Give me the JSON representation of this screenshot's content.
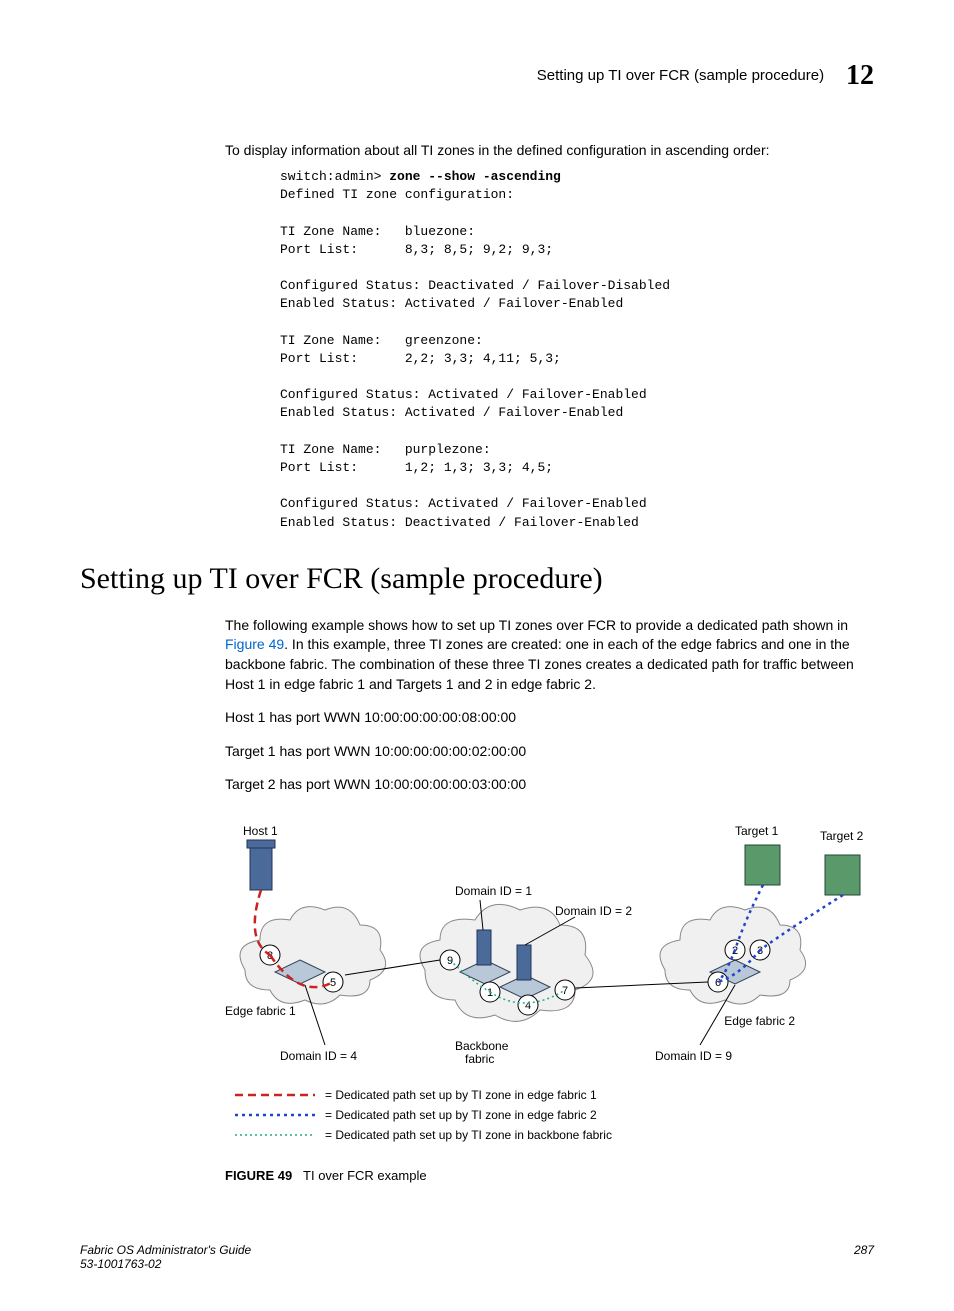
{
  "header": {
    "title": "Setting up TI over FCR (sample procedure)",
    "chapter": "12"
  },
  "intro": "To display information about all TI zones in the defined configuration in ascending order:",
  "cli": {
    "prompt": "switch:admin> ",
    "command": "zone --show -ascending",
    "output": "Defined TI zone configuration:\n\nTI Zone Name:   bluezone:\nPort List:      8,3; 8,5; 9,2; 9,3;\n\nConfigured Status: Deactivated / Failover-Disabled\nEnabled Status: Activated / Failover-Enabled\n\nTI Zone Name:   greenzone:\nPort List:      2,2; 3,3; 4,11; 5,3;\n\nConfigured Status: Activated / Failover-Enabled\nEnabled Status: Activated / Failover-Enabled\n\nTI Zone Name:   purplezone:\nPort List:      1,2; 1,3; 3,3; 4,5;\n\nConfigured Status: Activated / Failover-Enabled\nEnabled Status: Deactivated / Failover-Enabled"
  },
  "section_heading": "Setting up TI over FCR (sample procedure)",
  "para1_a": "The following example shows how to set up TI zones over FCR to provide a dedicated path shown in ",
  "para1_link": "Figure 49",
  "para1_b": ". In this example, three TI zones are created: one in each of the edge fabrics and one in the backbone fabric. The combination of these three TI zones creates a dedicated path for traffic between Host 1 in edge fabric 1 and Targets 1 and 2 in edge fabric 2.",
  "wwn_lines": {
    "host1": "Host 1 has port WWN 10:00:00:00:00:08:00:00",
    "target1": "Target 1 has port WWN 10:00:00:00:00:02:00:00",
    "target2": "Target 2 has port WWN 10:00:00:00:00:03:00:00"
  },
  "diagram": {
    "host1": "Host 1",
    "target1": "Target 1",
    "target2": "Target 2",
    "domain1": "Domain ID = 1",
    "domain2": "Domain ID = 2",
    "domain4": "Domain ID = 4",
    "domain9": "Domain ID = 9",
    "edge1": "Edge fabric 1",
    "edge2": "Edge fabric 2",
    "backbone": "Backbone\nfabric",
    "p8": "8",
    "p5": "5",
    "p9": "9",
    "p1": "1",
    "p4": "4",
    "p7": "7",
    "p6": "6",
    "p2": "2",
    "p3": "3",
    "legend1": "= Dedicated path set up by TI zone in edge fabric 1",
    "legend2": "= Dedicated path set up by TI zone in edge fabric 2",
    "legend3": "= Dedicated path set up by TI zone in backbone fabric"
  },
  "figure_caption": {
    "label": "FIGURE 49",
    "text": "TI over FCR example"
  },
  "footer": {
    "left1": "Fabric OS Administrator's Guide",
    "left2": "53-1001763-02",
    "page": "287"
  }
}
